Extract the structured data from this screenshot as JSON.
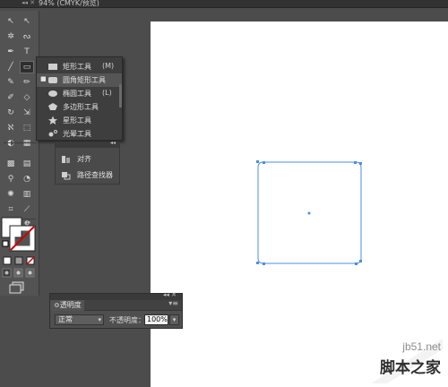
{
  "document": {
    "tab_title": "94% (CMYK/预览)",
    "grip": "◂◂ ✕"
  },
  "tools": [
    {
      "name": "selection-tool-icon",
      "glyph": "↖"
    },
    {
      "name": "direct-selection-tool-icon",
      "glyph": "↖"
    },
    {
      "name": "magic-wand-tool-icon",
      "glyph": "✲"
    },
    {
      "name": "lasso-tool-icon",
      "glyph": "ᔓ"
    },
    {
      "name": "pen-tool-icon",
      "glyph": "✒"
    },
    {
      "name": "type-tool-icon",
      "glyph": "T"
    },
    {
      "name": "line-segment-tool-icon",
      "glyph": "╱"
    },
    {
      "name": "rectangle-tool-icon",
      "glyph": "▭"
    },
    {
      "name": "paintbrush-tool-icon",
      "glyph": "✎"
    },
    {
      "name": "pencil-tool-icon",
      "glyph": "✏"
    },
    {
      "name": "blob-brush-tool-icon",
      "glyph": "✐"
    },
    {
      "name": "eraser-tool-icon",
      "glyph": "◇"
    },
    {
      "name": "rotate-tool-icon",
      "glyph": "↻"
    },
    {
      "name": "scale-tool-icon",
      "glyph": "⇲"
    },
    {
      "name": "warp-tool-icon",
      "glyph": "ℵ"
    },
    {
      "name": "free-transform-tool-icon",
      "glyph": "⬚"
    },
    {
      "name": "shape-builder-tool-icon",
      "glyph": "◐"
    },
    {
      "name": "perspective-grid-tool-icon",
      "glyph": "▦"
    },
    {
      "name": "mesh-tool-icon",
      "glyph": "▩"
    },
    {
      "name": "gradient-tool-icon",
      "glyph": "▤"
    },
    {
      "name": "eyedropper-tool-icon",
      "glyph": "⚲"
    },
    {
      "name": "blend-tool-icon",
      "glyph": "◔"
    },
    {
      "name": "symbol-sprayer-tool-icon",
      "glyph": "✺"
    },
    {
      "name": "column-graph-tool-icon",
      "glyph": "▥"
    },
    {
      "name": "artboard-tool-icon",
      "glyph": "⌗"
    },
    {
      "name": "slice-tool-icon",
      "glyph": "⟋"
    },
    {
      "name": "hand-tool-icon",
      "glyph": "✋"
    },
    {
      "name": "zoom-tool-icon",
      "glyph": "⚲"
    }
  ],
  "shape_flyout": [
    {
      "label": "矩形工具",
      "key": "(M)",
      "bullet": "",
      "icon": "rect-icon"
    },
    {
      "label": "圆角矩形工具",
      "key": "",
      "bullet": "■",
      "icon": "rounded-rect-icon"
    },
    {
      "label": "椭圆工具",
      "key": "(L)",
      "bullet": "",
      "icon": "ellipse-icon"
    },
    {
      "label": "多边形工具",
      "key": "",
      "bullet": "",
      "icon": "polygon-icon"
    },
    {
      "label": "星形工具",
      "key": "",
      "bullet": "",
      "icon": "star-icon"
    },
    {
      "label": "光晕工具",
      "key": "",
      "bullet": "",
      "icon": "flare-icon"
    }
  ],
  "align_panel": {
    "collapse": "◂◂",
    "items": [
      {
        "label": "对齐",
        "icon": "align-icon"
      },
      {
        "label": "路径查找器",
        "icon": "pathfinder-icon"
      }
    ]
  },
  "transparency_panel": {
    "bar_controls": "◂◂ ✕",
    "tab_label": "≎透明度",
    "menu": "▾≡",
    "blend_mode": "正常",
    "opacity_label": "不透明度：",
    "opacity_value": "100%"
  },
  "watermark": {
    "url": "jb51.net",
    "name": "脚本之家"
  },
  "colors": {
    "ui_dark": "#535353",
    "canvas": "#ffffff",
    "path_stroke": "#4a8fe0",
    "stroke_red": "#d40000"
  }
}
